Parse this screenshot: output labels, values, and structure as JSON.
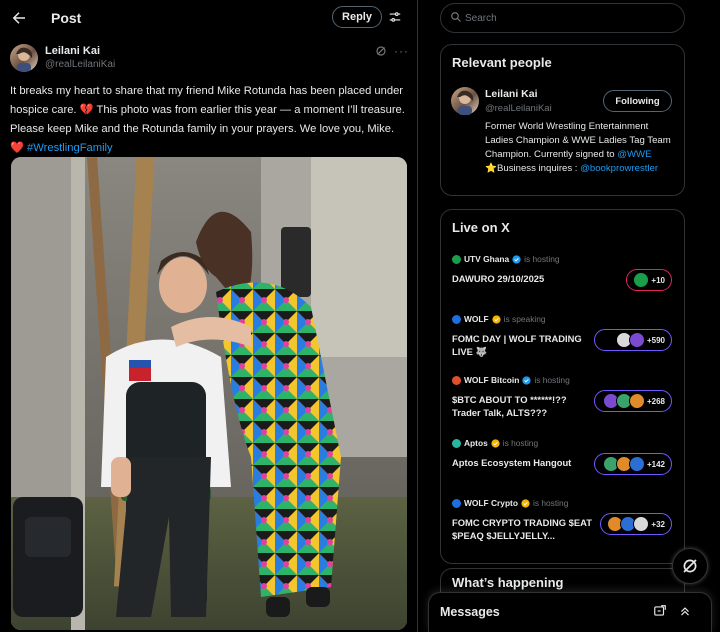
{
  "header": {
    "title": "Post",
    "reply_label": "Reply"
  },
  "post": {
    "author_name": "Leilani Kai",
    "author_handle": "@realLeilaniKai",
    "text_part1": "It breaks my heart to share that my friend Mike Rotunda has been placed under hospice care. ",
    "broken_heart": "💔",
    "text_part2": " This photo was from earlier this year — a moment I’ll treasure. Please keep Mike and the Rotunda family in your prayers. We love you, Mike. ",
    "heart": "❤️",
    "hashtag": "#WrestlingFamily"
  },
  "search": {
    "placeholder": "Search"
  },
  "relevant_people": {
    "title": "Relevant people",
    "name": "Leilani Kai",
    "handle": "@realLeilaniKai",
    "follow_label": "Following",
    "bio_part1": "Former World Wrestling Entertainment Ladies Champion & WWE Ladies Tag Team Champion. Currently signed to ",
    "bio_link1": "@WWE",
    "bio_star": "⭐",
    "bio_part2": "Business inquires : ",
    "bio_link2": "@bookprowrestler"
  },
  "live": {
    "title": "Live on X",
    "items": [
      {
        "host": "UTV Ghana",
        "status": "is hosting",
        "title": "DAWURO 29/10/2025",
        "count": "+10",
        "badge_color": "#1b9e4b",
        "ring_color": "#e0245e"
      },
      {
        "host": "WOLF",
        "status": "is speaking",
        "title": "FOMC DAY | WOLF TRADING LIVE 🐺",
        "count": "+590",
        "badge_color": "#1d6fe0",
        "ring_color": "#7856ff"
      },
      {
        "host": "WOLF Bitcoin",
        "status": "is hosting",
        "title": "$BTC ABOUT TO ******!?? Trader Talk, ALTS???",
        "count": "+268",
        "badge_color": "#e0502a",
        "ring_color": "#7856ff"
      },
      {
        "host": "Aptos",
        "status": "is hosting",
        "title": "Aptos Ecosystem Hangout",
        "count": "+142",
        "badge_color": "#2bb5a0",
        "ring_color": "#7856ff"
      },
      {
        "host": "WOLF Crypto",
        "status": "is hosting",
        "title": "FOMC CRYPTO TRADING $EAT $PEAQ $JELLYJELLY...",
        "count": "+32",
        "badge_color": "#1d6fe0",
        "ring_color": "#7856ff"
      }
    ]
  },
  "whats_happening": {
    "title": "What’s happening"
  },
  "messages": {
    "title": "Messages"
  },
  "colors": {
    "background": "#000000",
    "accent": "#1d9bf0",
    "border": "#2f3336",
    "muted": "#71767b",
    "heart": "#f91880"
  },
  "icons": [
    "back-arrow-icon",
    "sliders-icon",
    "grok-icon",
    "more-icon",
    "search-icon",
    "verified-icon",
    "grok-fab-icon",
    "compose-message-icon",
    "collapse-icon"
  ]
}
